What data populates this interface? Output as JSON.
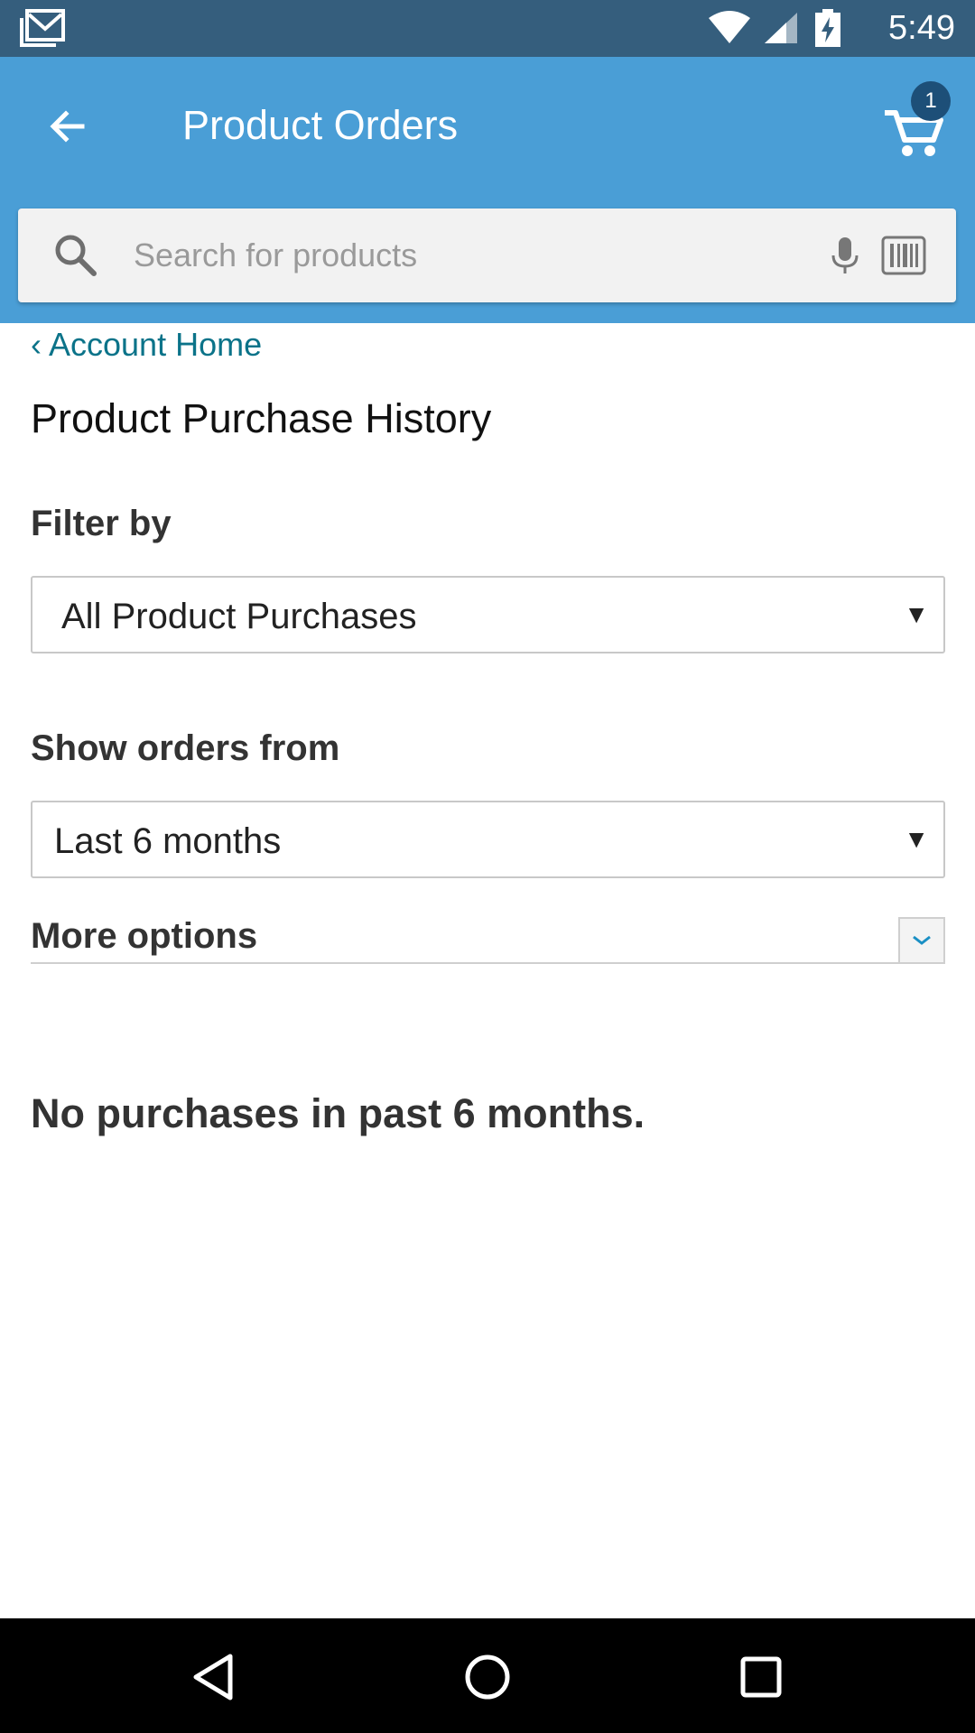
{
  "status_bar": {
    "time": "5:49",
    "icons": [
      "gmail-notification-icon",
      "wifi-icon",
      "signal-icon",
      "battery-charging-icon"
    ]
  },
  "app_bar": {
    "title": "Product Orders",
    "back_icon": "arrow-left-icon",
    "cart_icon": "shopping-cart-icon",
    "cart_count": "1",
    "background": "#4a9ed6"
  },
  "search": {
    "placeholder": "Search for products",
    "value": "",
    "icons": [
      "search-icon",
      "mic-icon",
      "barcode-icon"
    ]
  },
  "content": {
    "breadcrumb": "‹ Account Home",
    "page_title": "Product Purchase History",
    "filter_label": "Filter by",
    "filter_value": "All Product Purchases",
    "show_orders_label": "Show orders from",
    "show_orders_value": "Last 6 months",
    "more_options_label": "More options",
    "empty_message": "No purchases in past 6 months.",
    "link_color": "#0b7389"
  },
  "nav_bar": {
    "icons": [
      "nav-back-icon",
      "nav-home-icon",
      "nav-recent-apps-icon"
    ]
  }
}
